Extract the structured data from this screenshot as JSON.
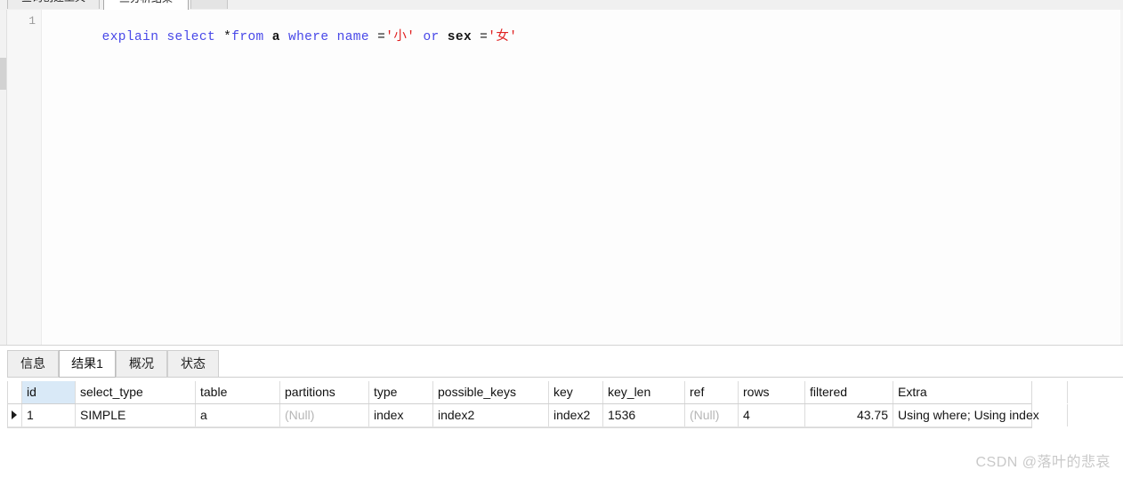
{
  "window": {
    "app": "Navicat Query Editor"
  },
  "top_tabs": [
    {
      "label": "查询创建工具",
      "active": false
    },
    {
      "label": "三分析结果",
      "active": true
    },
    {
      "label": "",
      "active": false
    }
  ],
  "editor": {
    "line_number": "1",
    "code_plain": "explain select *from a where name ='小' or sex ='女'",
    "tokens": [
      {
        "text": "explain",
        "type": "keyword"
      },
      {
        "text": " ",
        "type": "plain"
      },
      {
        "text": "select",
        "type": "keyword"
      },
      {
        "text": " *",
        "type": "operator"
      },
      {
        "text": "from",
        "type": "keyword"
      },
      {
        "text": " ",
        "type": "plain"
      },
      {
        "text": "a",
        "type": "identifier"
      },
      {
        "text": " ",
        "type": "plain"
      },
      {
        "text": "where",
        "type": "keyword"
      },
      {
        "text": " ",
        "type": "plain"
      },
      {
        "text": "name",
        "type": "keyword"
      },
      {
        "text": " =",
        "type": "operator"
      },
      {
        "text": "'小'",
        "type": "string"
      },
      {
        "text": " ",
        "type": "plain"
      },
      {
        "text": "or",
        "type": "keyword"
      },
      {
        "text": " ",
        "type": "plain"
      },
      {
        "text": "sex",
        "type": "identifier"
      },
      {
        "text": " =",
        "type": "operator"
      },
      {
        "text": "'女'",
        "type": "string"
      }
    ],
    "colors": {
      "keyword": "#4848e8",
      "string": "#e02020",
      "identifier": "#141414",
      "background": "#fdfdfd",
      "gutter": "#f7f7f7",
      "gutter_text": "#9b9b9b"
    }
  },
  "bottom_tabs": [
    {
      "label": "信息",
      "active": false
    },
    {
      "label": "结果1",
      "active": true
    },
    {
      "label": "概况",
      "active": false
    },
    {
      "label": "状态",
      "active": false
    }
  ],
  "grid": {
    "selected_column": "id",
    "selection_color": "#d9e9f7",
    "null_color": "#b6b6b6",
    "columns": [
      "id",
      "select_type",
      "table",
      "partitions",
      "type",
      "possible_keys",
      "key",
      "key_len",
      "ref",
      "rows",
      "filtered",
      "Extra"
    ],
    "rows": [
      {
        "marked": true,
        "cells": {
          "id": "1",
          "select_type": "SIMPLE",
          "table": "a",
          "partitions": "(Null)",
          "type": "index",
          "possible_keys": "index2",
          "key": "index2",
          "key_len": "1536",
          "ref": "(Null)",
          "rows": "4",
          "filtered": "43.75",
          "Extra": "Using where; Using index"
        }
      }
    ]
  },
  "watermark": {
    "text": "CSDN @落叶的悲哀"
  }
}
